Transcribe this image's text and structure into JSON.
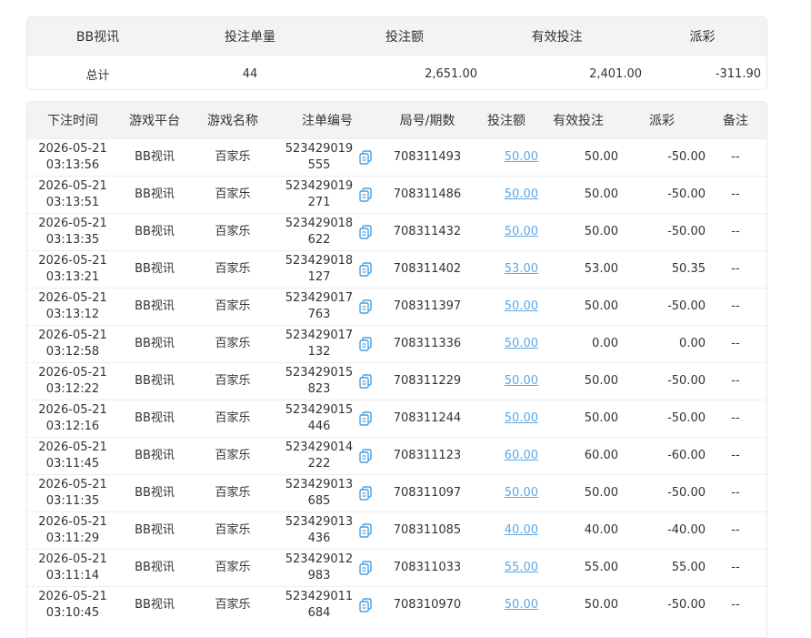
{
  "summary": {
    "headers": [
      "BB视讯",
      "投注单量",
      "投注额",
      "有效投注",
      "派彩"
    ],
    "total_label": "总计",
    "bet_count": "44",
    "bet_amount": "2,651.00",
    "valid_bet": "2,401.00",
    "payout": "-311.90"
  },
  "table": {
    "headers": [
      "下注时间",
      "游戏平台",
      "游戏名称",
      "注单编号",
      "局号/期数",
      "投注额",
      "有效投注",
      "派彩",
      "备注"
    ],
    "rows": [
      {
        "date": "2026-05-21",
        "time": "03:13:56",
        "platform": "BB视讯",
        "game": "百家乐",
        "order": "523429019555",
        "round": "708311493",
        "bet": "50.00",
        "valid": "50.00",
        "payout": "-50.00",
        "note": "--",
        "neg": true
      },
      {
        "date": "2026-05-21",
        "time": "03:13:51",
        "platform": "BB视讯",
        "game": "百家乐",
        "order": "523429019271",
        "round": "708311486",
        "bet": "50.00",
        "valid": "50.00",
        "payout": "-50.00",
        "note": "--",
        "neg": true
      },
      {
        "date": "2026-05-21",
        "time": "03:13:35",
        "platform": "BB视讯",
        "game": "百家乐",
        "order": "523429018622",
        "round": "708311432",
        "bet": "50.00",
        "valid": "50.00",
        "payout": "-50.00",
        "note": "--",
        "neg": true
      },
      {
        "date": "2026-05-21",
        "time": "03:13:21",
        "platform": "BB视讯",
        "game": "百家乐",
        "order": "523429018127",
        "round": "708311402",
        "bet": "53.00",
        "valid": "53.00",
        "payout": "50.35",
        "note": "--",
        "neg": false
      },
      {
        "date": "2026-05-21",
        "time": "03:13:12",
        "platform": "BB视讯",
        "game": "百家乐",
        "order": "523429017763",
        "round": "708311397",
        "bet": "50.00",
        "valid": "50.00",
        "payout": "-50.00",
        "note": "--",
        "neg": true
      },
      {
        "date": "2026-05-21",
        "time": "03:12:58",
        "platform": "BB视讯",
        "game": "百家乐",
        "order": "523429017132",
        "round": "708311336",
        "bet": "50.00",
        "valid": "0.00",
        "payout": "0.00",
        "note": "--",
        "neg": false
      },
      {
        "date": "2026-05-21",
        "time": "03:12:22",
        "platform": "BB视讯",
        "game": "百家乐",
        "order": "523429015823",
        "round": "708311229",
        "bet": "50.00",
        "valid": "50.00",
        "payout": "-50.00",
        "note": "--",
        "neg": true
      },
      {
        "date": "2026-05-21",
        "time": "03:12:16",
        "platform": "BB视讯",
        "game": "百家乐",
        "order": "523429015446",
        "round": "708311244",
        "bet": "50.00",
        "valid": "50.00",
        "payout": "-50.00",
        "note": "--",
        "neg": true
      },
      {
        "date": "2026-05-21",
        "time": "03:11:45",
        "platform": "BB视讯",
        "game": "百家乐",
        "order": "523429014222",
        "round": "708311123",
        "bet": "60.00",
        "valid": "60.00",
        "payout": "-60.00",
        "note": "--",
        "neg": true
      },
      {
        "date": "2026-05-21",
        "time": "03:11:35",
        "platform": "BB视讯",
        "game": "百家乐",
        "order": "523429013685",
        "round": "708311097",
        "bet": "50.00",
        "valid": "50.00",
        "payout": "-50.00",
        "note": "--",
        "neg": true
      },
      {
        "date": "2026-05-21",
        "time": "03:11:29",
        "platform": "BB视讯",
        "game": "百家乐",
        "order": "523429013436",
        "round": "708311085",
        "bet": "40.00",
        "valid": "40.00",
        "payout": "-40.00",
        "note": "--",
        "neg": true
      },
      {
        "date": "2026-05-21",
        "time": "03:11:14",
        "platform": "BB视讯",
        "game": "百家乐",
        "order": "523429012983",
        "round": "708311033",
        "bet": "55.00",
        "valid": "55.00",
        "payout": "55.00",
        "note": "--",
        "neg": false
      },
      {
        "date": "2026-05-21",
        "time": "03:10:45",
        "platform": "BB视讯",
        "game": "百家乐",
        "order": "523429011684",
        "round": "708310970",
        "bet": "50.00",
        "valid": "50.00",
        "payout": "-50.00",
        "note": "--",
        "neg": true
      }
    ]
  },
  "colors": {
    "negative": "#f0506e",
    "link": "#5ba8e8",
    "header_bg": "#f2f3f5"
  },
  "icons": {
    "copy": "copy-icon"
  }
}
